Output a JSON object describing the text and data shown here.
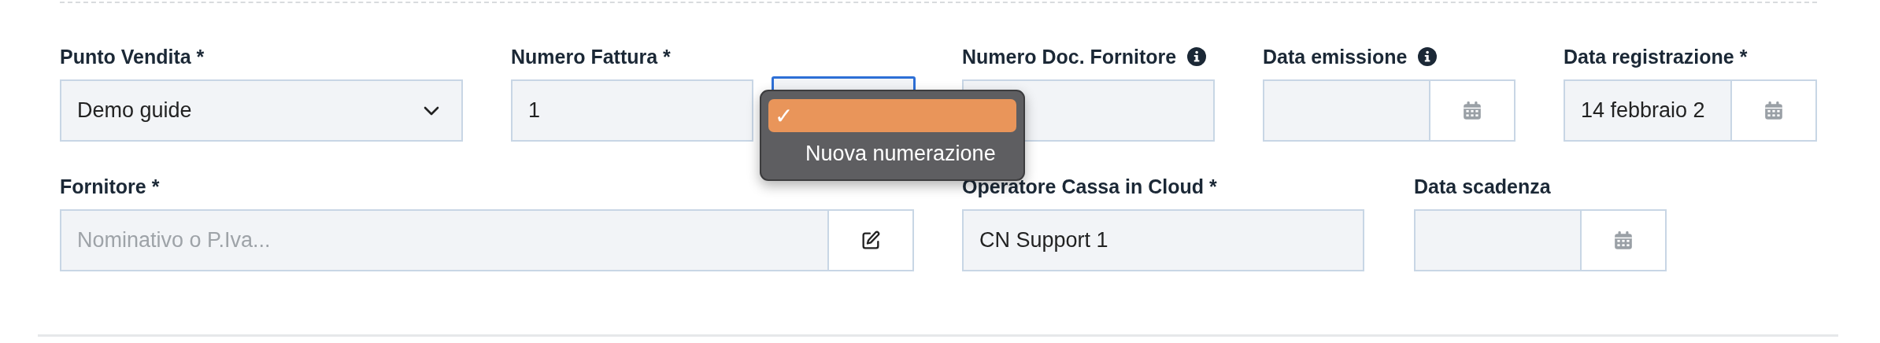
{
  "rows": [
    [
      {
        "label": "Punto Vendita *",
        "kind": "select",
        "value": "Demo guide"
      },
      {
        "label": "Numero Fattura *",
        "kind": "numbering",
        "value": "1",
        "menu": {
          "check_mark": "✓",
          "items": [
            {
              "selected": true
            },
            {
              "label": "Nuova numerazione",
              "selected": false
            }
          ]
        }
      },
      {
        "label": "Numero Doc. Fornitore",
        "info": true,
        "kind": "text"
      },
      {
        "label": "Data emissione",
        "info": true,
        "kind": "date"
      },
      {
        "label": "Data registrazione *",
        "kind": "date",
        "value": "14 febbraio 2"
      }
    ],
    [
      {
        "label": "Fornitore *",
        "kind": "lookup",
        "placeholder": "Nominativo o P.Iva..."
      },
      {
        "label": "Operatore Cassa in Cloud *",
        "kind": "text",
        "value": "CN Support 1"
      },
      {
        "label": "Data scadenza",
        "kind": "date"
      }
    ]
  ]
}
